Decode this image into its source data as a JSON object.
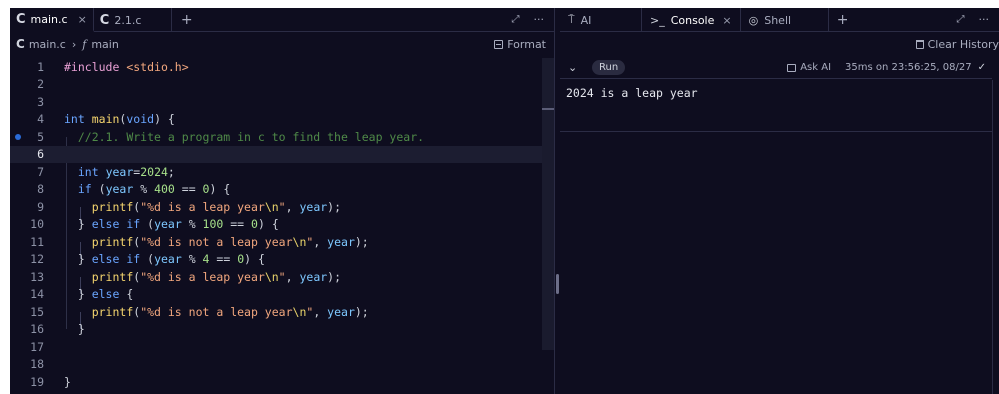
{
  "editor": {
    "tabs": [
      {
        "label": "main.c",
        "close": "×"
      },
      {
        "label": "2.1.c"
      }
    ],
    "new_tab": "+",
    "expand_icon": "expand-icon",
    "more": "···",
    "breadcrumb": {
      "file": "main.c",
      "separator": "›",
      "fn_symbol": "f",
      "function": "main"
    },
    "format_label": "Format",
    "current_line": 6,
    "breakpoint_line": 5,
    "line_numbers": [
      "1",
      "2",
      "3",
      "4",
      "5",
      "6",
      "7",
      "8",
      "9",
      "10",
      "11",
      "12",
      "13",
      "14",
      "15",
      "16",
      "17",
      "18",
      "19"
    ]
  },
  "console": {
    "tabs": [
      {
        "label": "AI",
        "icon": "ai-icon"
      },
      {
        "label": "Console",
        "icon": "terminal-icon",
        "close": "×"
      },
      {
        "label": "Shell",
        "icon": "shell-icon"
      }
    ],
    "new_tab": "+",
    "clear_history": "Clear History",
    "run_label": "Run",
    "ask_ai": "Ask AI",
    "timing": "35ms on 23:56:25, 08/27",
    "output": "2024 is a leap year"
  }
}
